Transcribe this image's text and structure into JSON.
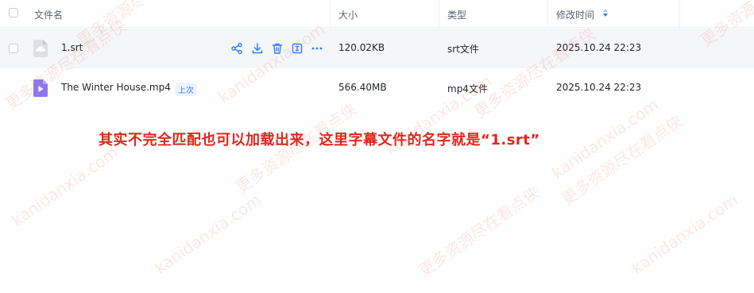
{
  "header": {
    "name_label": "文件名",
    "size_label": "大小",
    "type_label": "类型",
    "modified_label": "修改时间"
  },
  "files": [
    {
      "name": "1.srt",
      "size": "120.02KB",
      "type": "srt文件",
      "modified": "2025.10.24 22:23",
      "icon": "cloud-file-icon",
      "badge": ""
    },
    {
      "name": "The Winter House.mp4",
      "size": "566.40MB",
      "type": "mp4文件",
      "modified": "2025.10.24 22:23",
      "icon": "video-file-icon",
      "badge": "上次"
    }
  ],
  "row_actions": [
    "share-icon",
    "download-icon",
    "delete-icon",
    "rename-icon",
    "more-icon"
  ],
  "annotation": "其实不完全匹配也可以加载出来，这里字幕文件的名字就是“1.srt”",
  "watermark": {
    "site": "kanidanxia.com",
    "tagline": "更多资源尽在看点侠"
  },
  "colors": {
    "accent": "#2f7cf6",
    "annotation": "#e1261c",
    "video_icon": "#8c78f0"
  }
}
